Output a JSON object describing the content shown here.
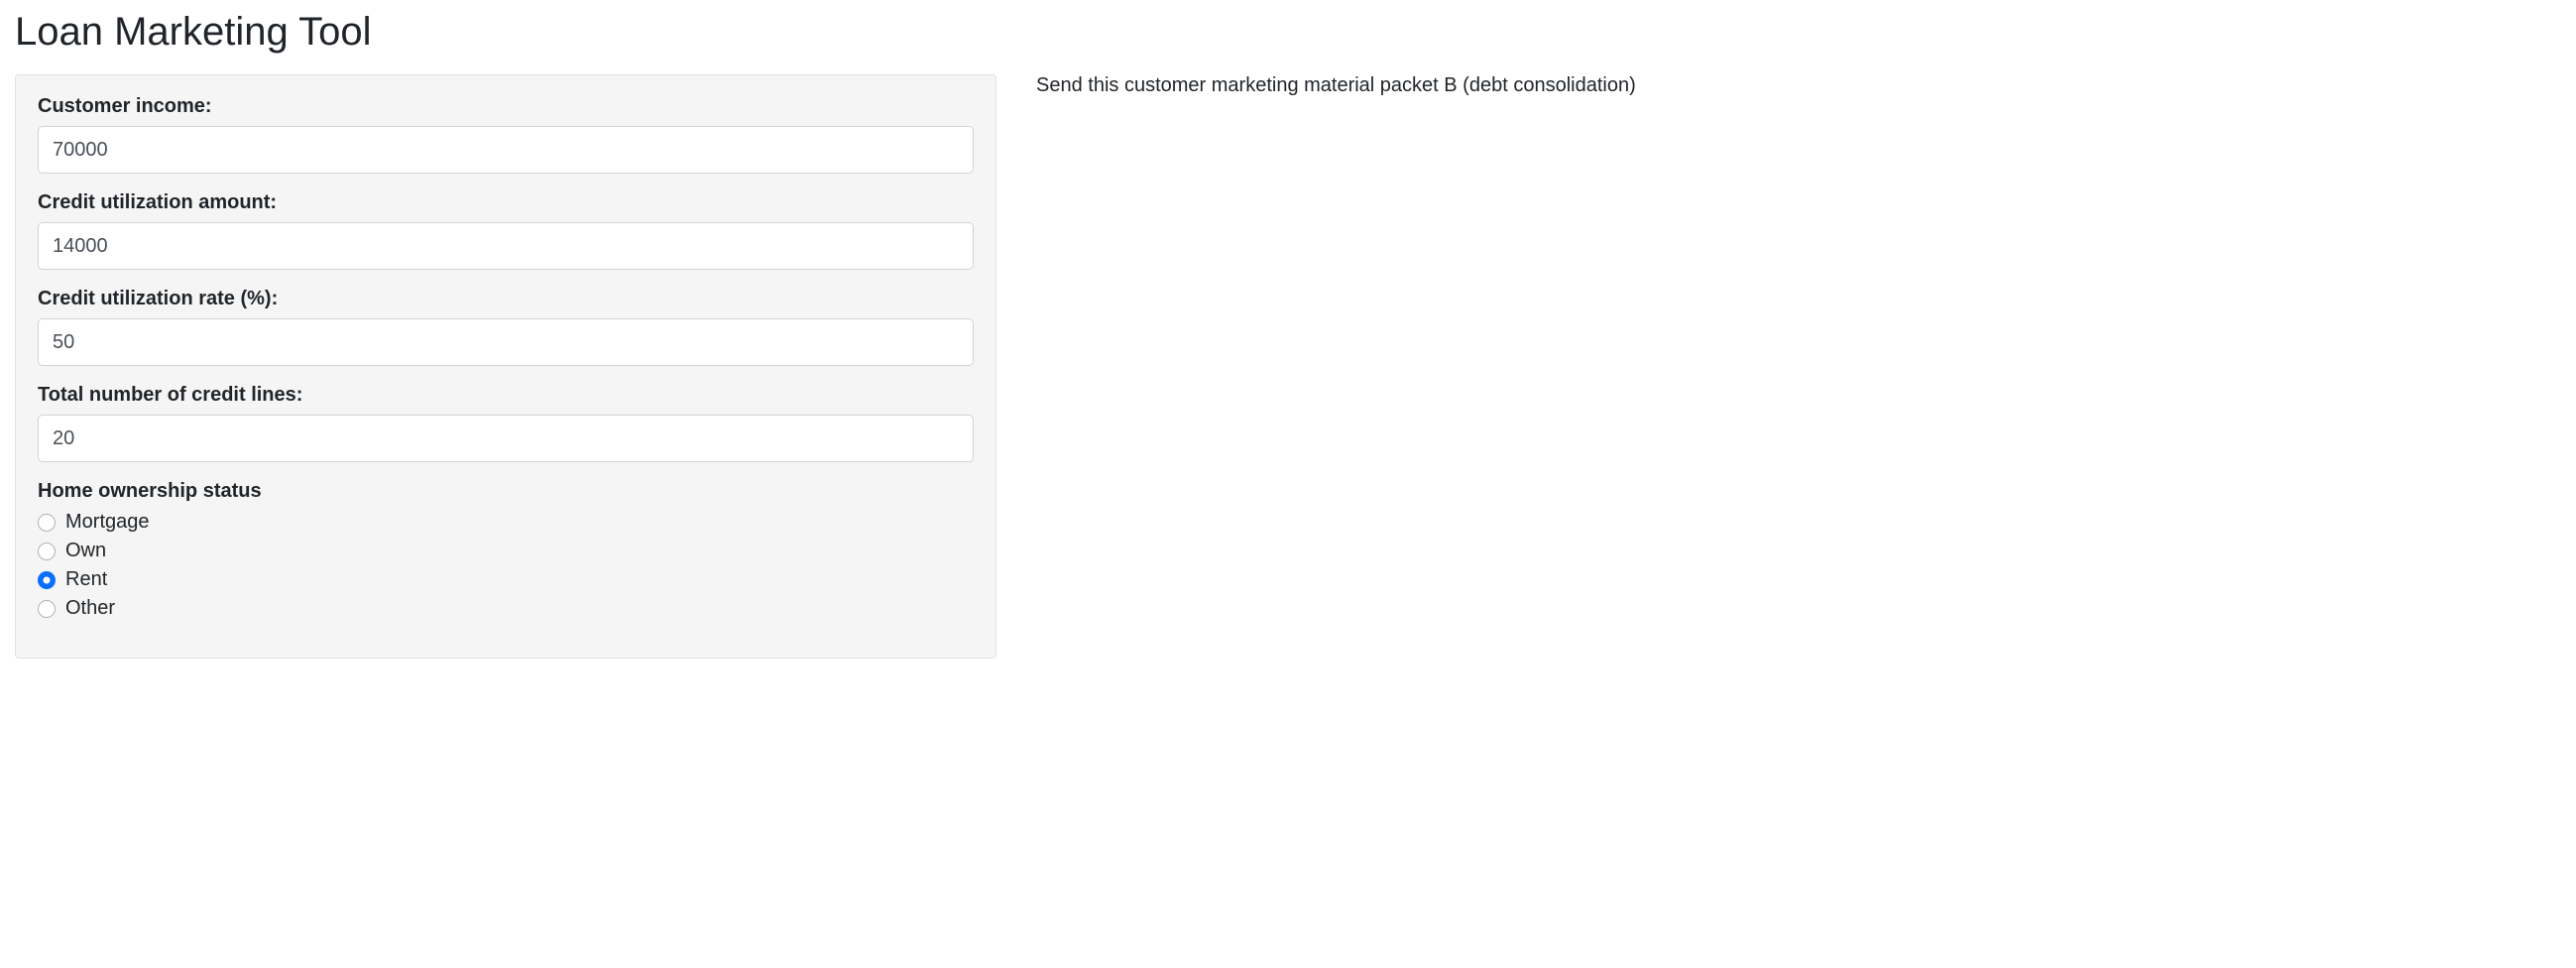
{
  "page": {
    "title": "Loan Marketing Tool"
  },
  "form": {
    "income": {
      "label": "Customer income:",
      "value": "70000"
    },
    "credit_util_amount": {
      "label": "Credit utilization amount:",
      "value": "14000"
    },
    "credit_util_rate": {
      "label": "Credit utilization rate (%):",
      "value": "50"
    },
    "total_credit_lines": {
      "label": "Total number of credit lines:",
      "value": "20"
    },
    "home_ownership": {
      "label": "Home ownership status",
      "selected": "Rent",
      "options": [
        {
          "label": "Mortgage"
        },
        {
          "label": "Own"
        },
        {
          "label": "Rent"
        },
        {
          "label": "Other"
        }
      ]
    }
  },
  "output": {
    "message": "Send this customer marketing material packet B (debt consolidation)"
  }
}
